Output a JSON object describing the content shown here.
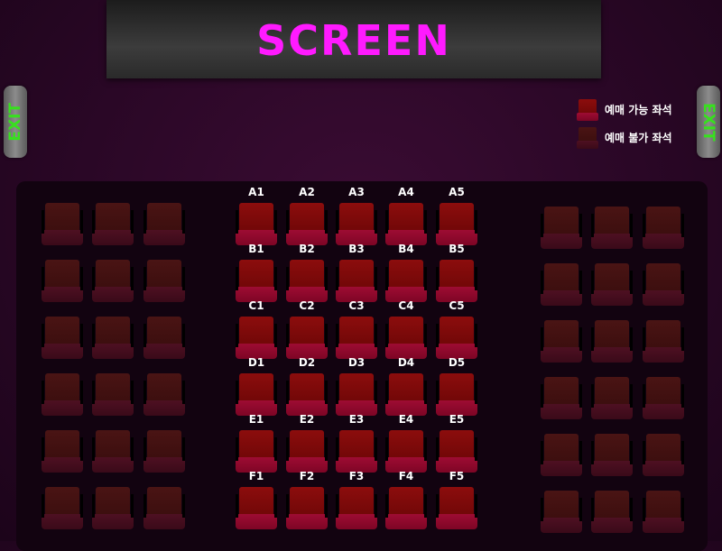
{
  "screen": {
    "label": "SCREEN"
  },
  "exits": {
    "left": "EXIT",
    "right": "EXIT"
  },
  "legend": {
    "available": "예매 가능 좌석",
    "unavailable": "예매 불가 좌석"
  },
  "colors": {
    "screen_text": "#ff1aff",
    "exit_text": "#37e01e",
    "available_seat": "#8c0d0d",
    "unavailable_seat": "#4a1414"
  },
  "seating": {
    "center_rows": [
      {
        "row": "A",
        "seats": [
          "A1",
          "A2",
          "A3",
          "A4",
          "A5"
        ]
      },
      {
        "row": "B",
        "seats": [
          "B1",
          "B2",
          "B3",
          "B4",
          "B5"
        ]
      },
      {
        "row": "C",
        "seats": [
          "C1",
          "C2",
          "C3",
          "C4",
          "C5"
        ]
      },
      {
        "row": "D",
        "seats": [
          "D1",
          "D2",
          "D3",
          "D4",
          "D5"
        ]
      },
      {
        "row": "E",
        "seats": [
          "E1",
          "E2",
          "E3",
          "E4",
          "E5"
        ]
      },
      {
        "row": "F",
        "seats": [
          "F1",
          "F2",
          "F3",
          "F4",
          "F5"
        ]
      }
    ],
    "center_status": "available",
    "side_blocks": {
      "left_columns": 3,
      "right_columns": 3,
      "rows": 6,
      "status": "unavailable"
    }
  }
}
